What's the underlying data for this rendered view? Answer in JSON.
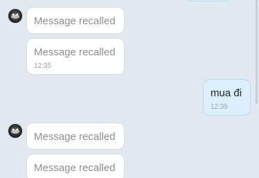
{
  "messages": [
    {
      "sender": "other",
      "text": "Message recalled",
      "time": ""
    },
    {
      "sender": "other",
      "text": "Message recalled",
      "time": "12:35"
    },
    {
      "sender": "me",
      "text": "mua đi",
      "time": "12:35"
    },
    {
      "sender": "other",
      "text": "Message recalled",
      "time": ""
    },
    {
      "sender": "other",
      "text": "Message recalled",
      "time": ""
    }
  ],
  "colors": {
    "background": "#e2e8f0",
    "incoming_bubble": "#ffffff",
    "outgoing_bubble": "#dcefff",
    "recalled_text": "#8a8f96",
    "time_text": "#9aa1a9"
  },
  "icons": [
    "avatar"
  ]
}
